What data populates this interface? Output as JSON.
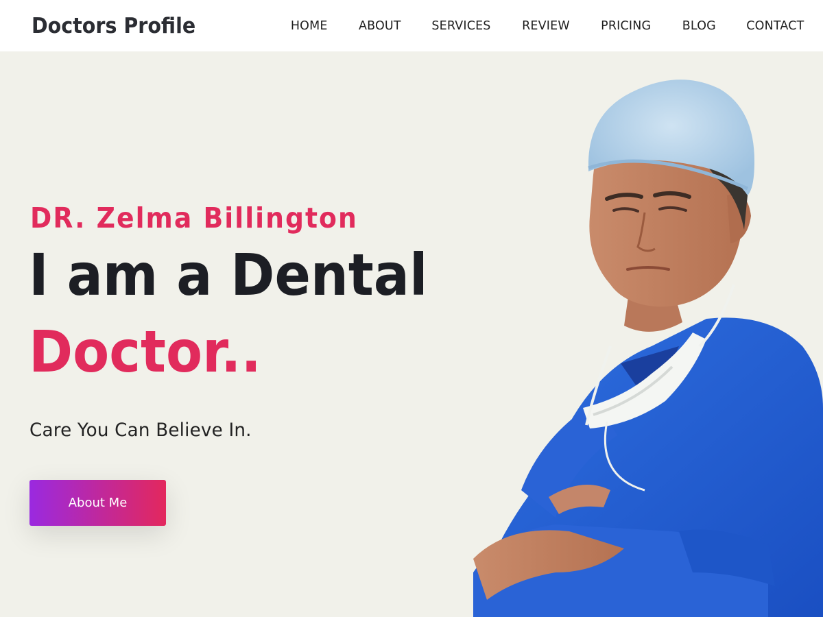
{
  "header": {
    "brand": "Doctors Profile",
    "nav": [
      "HOME",
      "ABOUT",
      "SERVICES",
      "REVIEW",
      "PRICING",
      "BLOG",
      "CONTACT"
    ]
  },
  "hero": {
    "doctor_name": "DR. Zelma Billington",
    "headline_line1": "I am a Dental",
    "headline_line2": "Doctor..",
    "tagline": "Care You Can Believe In.",
    "cta_label": "About Me",
    "image_subject": "doctor-photo"
  },
  "colors": {
    "accent": "#e12b5c",
    "dark": "#1c1e24",
    "background": "#f1f1ea",
    "button_gradient_start": "#9a29e0",
    "button_gradient_end": "#e3285d"
  }
}
